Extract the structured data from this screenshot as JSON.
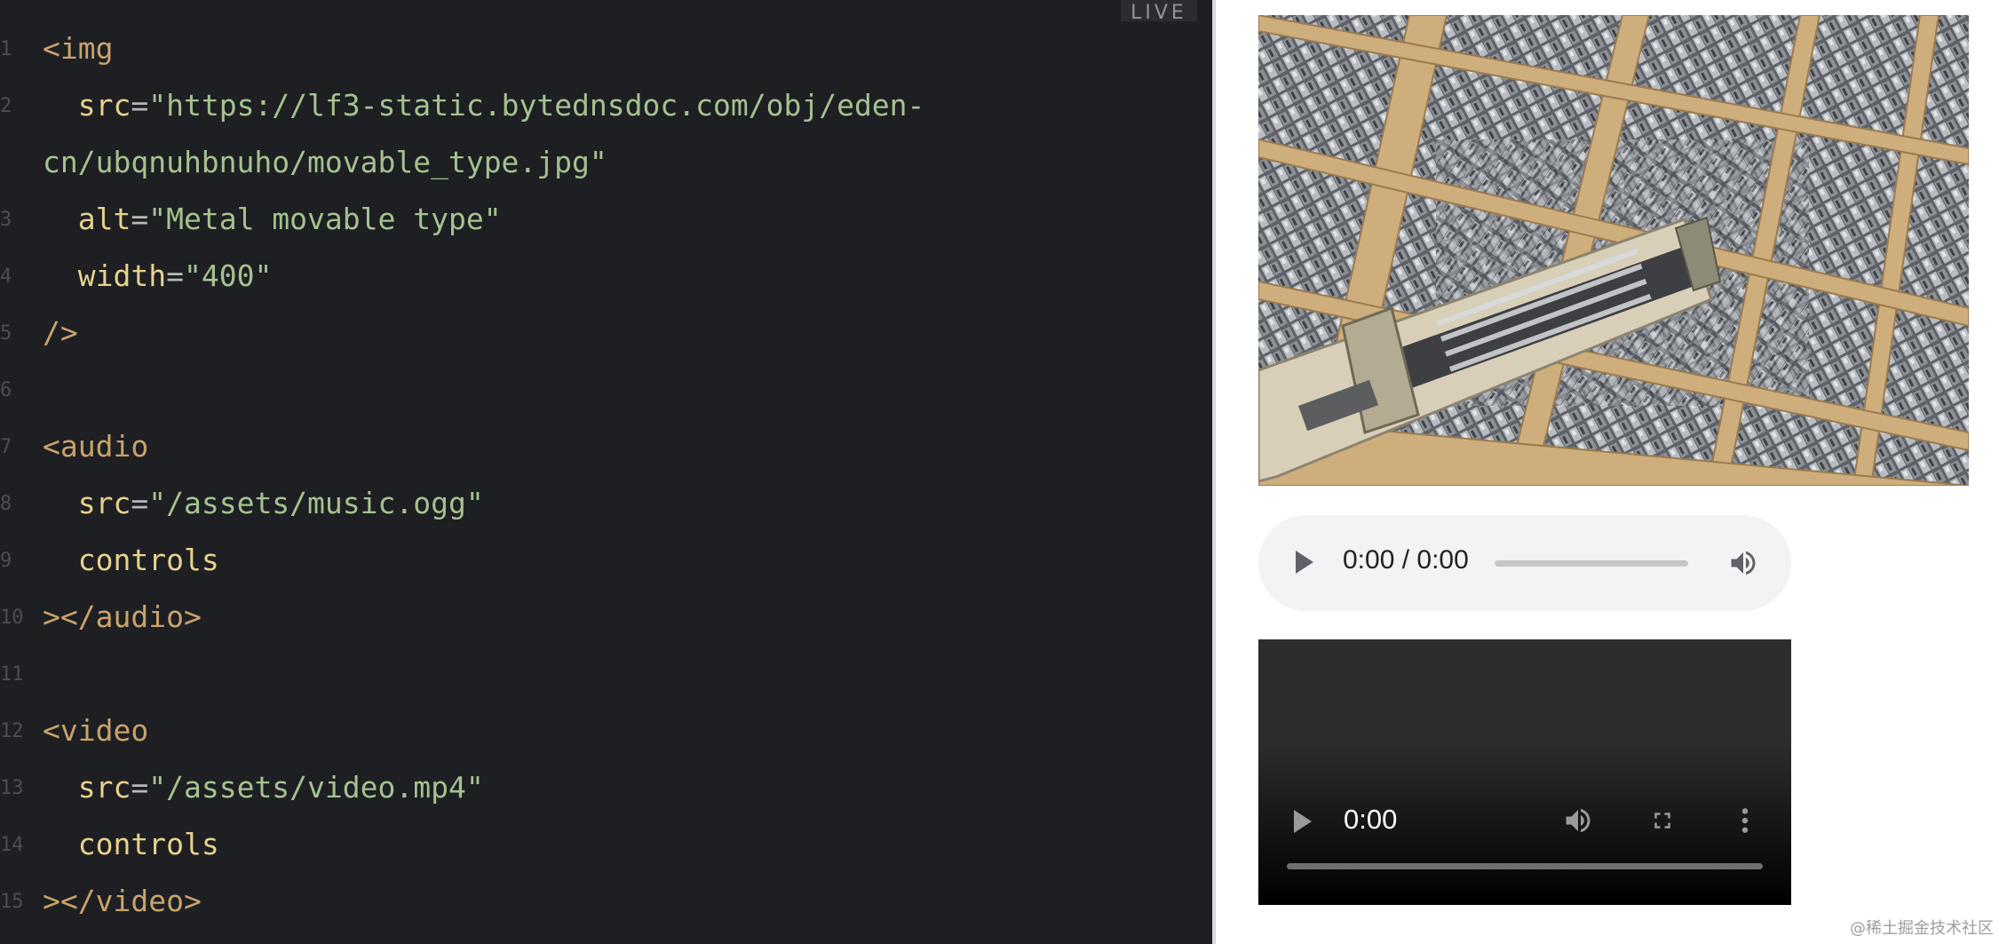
{
  "editor": {
    "line_numbers": [
      "1",
      "2",
      "",
      "3",
      "4",
      "5",
      "6",
      "7",
      "8",
      "9",
      "10",
      "11",
      "12",
      "13",
      "14",
      "15"
    ],
    "img": {
      "open": "<img",
      "src_attr": "src",
      "src_value_1": "\"https://lf3-static.bytednsdoc.com/obj/eden-",
      "src_value_2": "cn/ubqnuhbnuho/movable_type.jpg\"",
      "alt_attr": "alt",
      "alt_value": "\"Metal movable type\"",
      "width_attr": "width",
      "width_value": "\"400\"",
      "close": "/>"
    },
    "audio": {
      "open": "<audio",
      "src_attr": "src",
      "src_value": "\"/assets/music.ogg\"",
      "controls": "controls",
      "close": "></audio>"
    },
    "video": {
      "open": "<video",
      "src_attr": "src",
      "src_value": "\"/assets/video.mp4\"",
      "controls": "controls",
      "close": "></video>"
    }
  },
  "live_badge": "LIVE",
  "preview": {
    "audio_player": {
      "time": "0:00 / 0:00"
    },
    "video_player": {
      "time": "0:00"
    }
  },
  "icons": [
    "play-icon",
    "volume-icon",
    "fullscreen-icon",
    "more-options-icon"
  ],
  "colors": {
    "editor_bg": "#1d1f23",
    "tag": "#c9a36b",
    "attribute": "#e7d18c",
    "string": "#a5c28f",
    "audio_bg": "#f1f3f4"
  },
  "watermark": "@稀土掘金技术社区"
}
